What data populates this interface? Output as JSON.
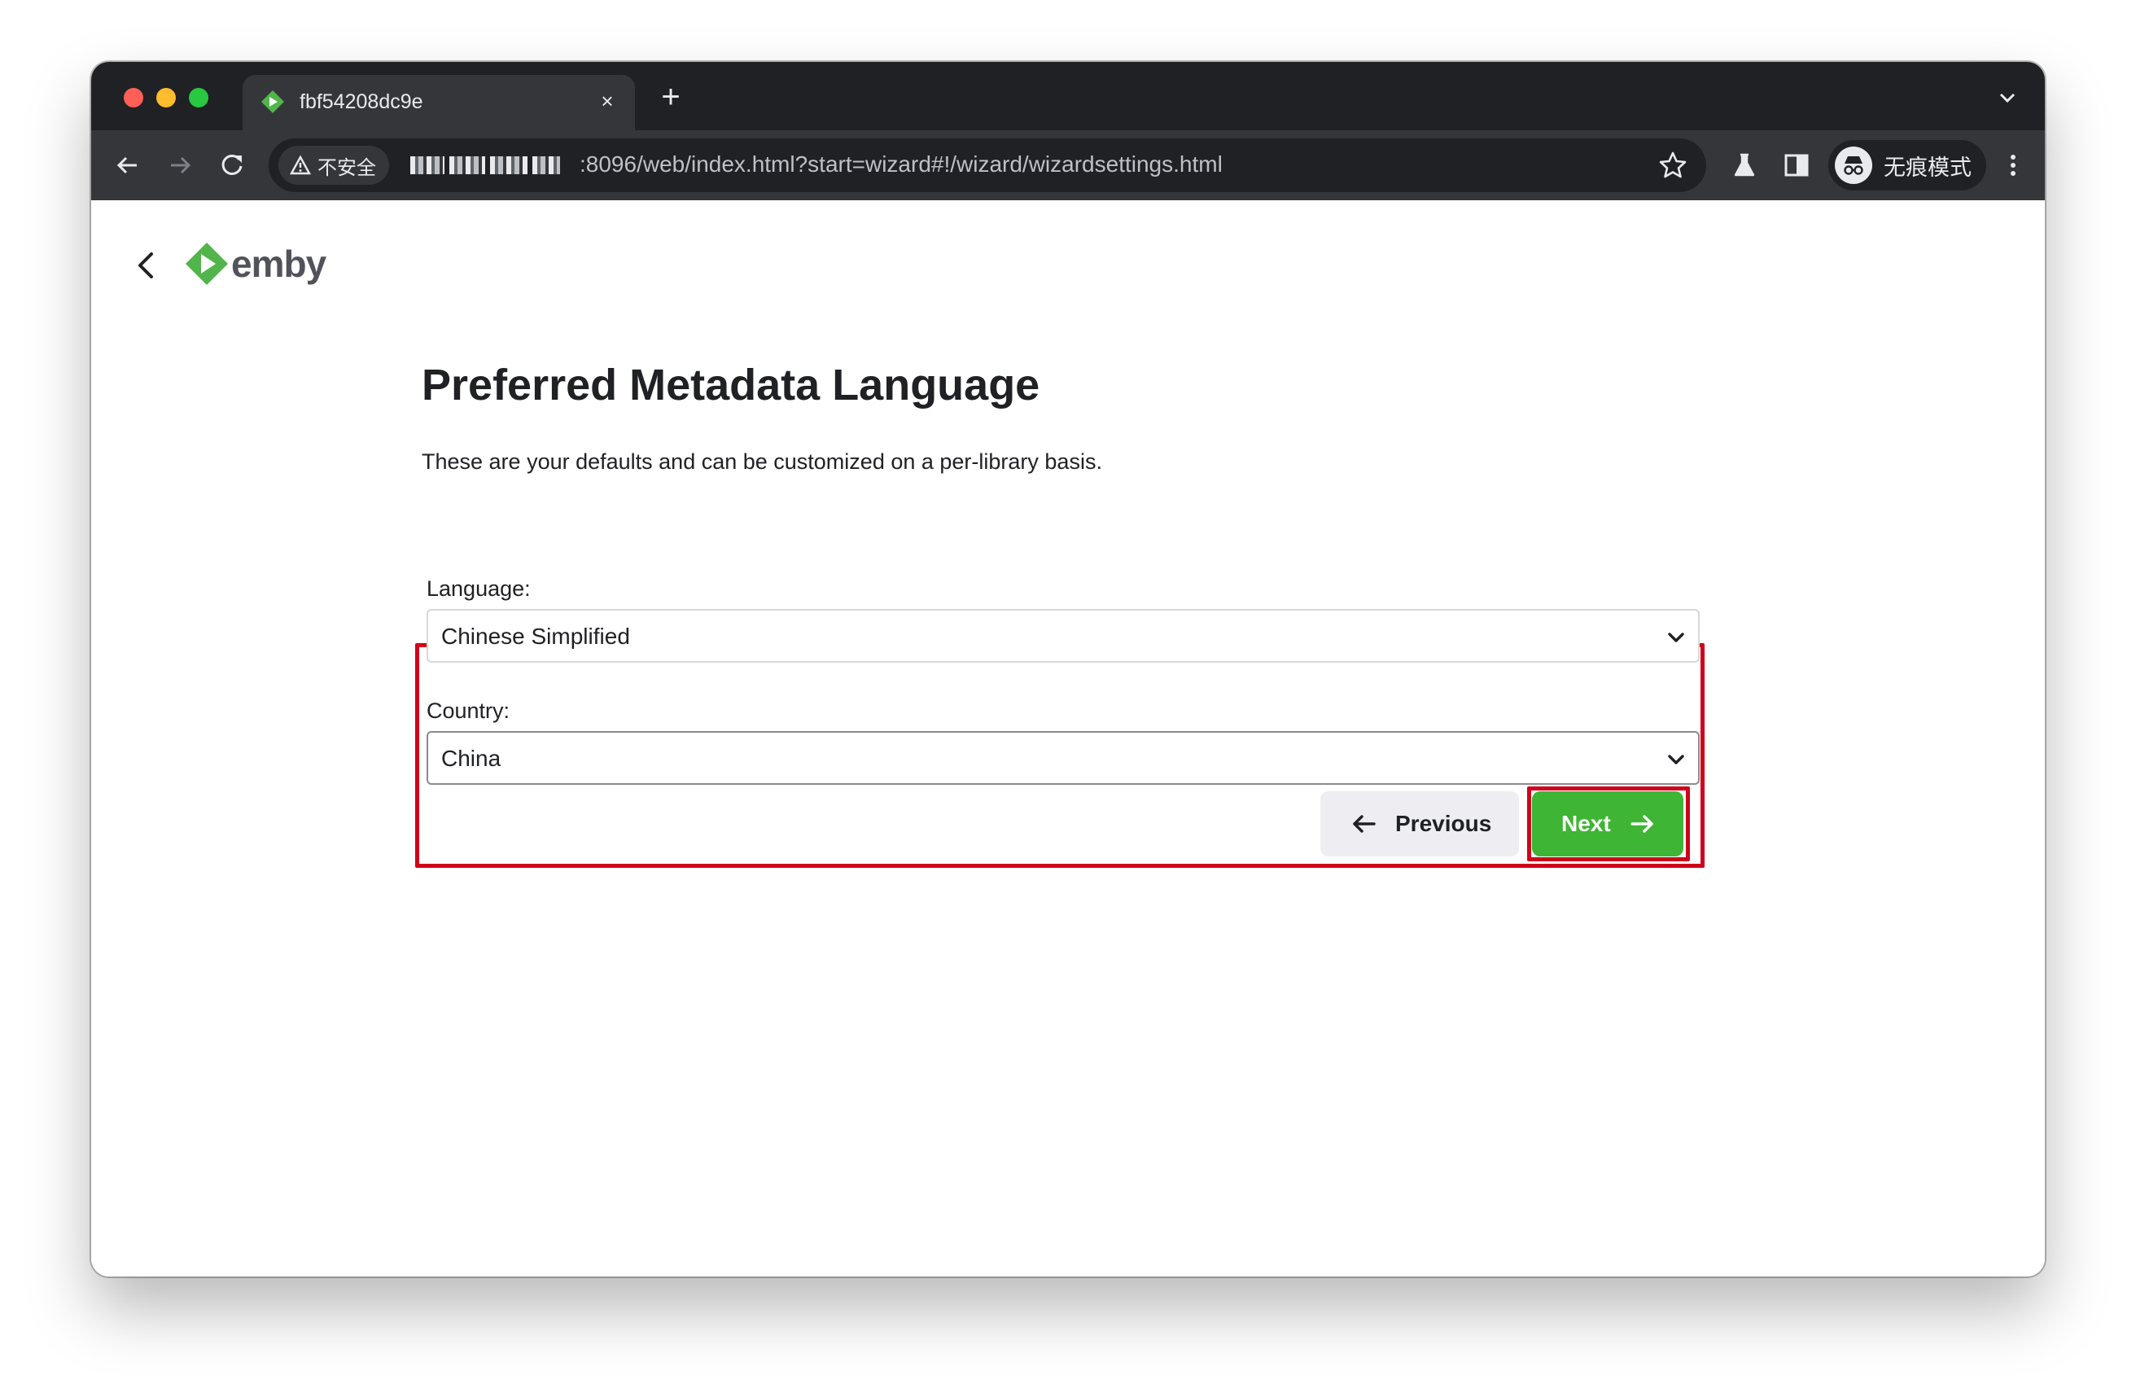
{
  "browser": {
    "tab_title": "fbf54208dc9e",
    "new_tab_symbol": "+",
    "close_symbol": "×",
    "security_label": "不安全",
    "url": ":8096/web/index.html?start=wizard#!/wizard/wizardsettings.html",
    "incognito_label": "无痕模式"
  },
  "header": {
    "logo_text": "emby"
  },
  "main": {
    "title": "Preferred Metadata Language",
    "subtitle": "These are your defaults and can be customized on a per-library basis.",
    "language_label": "Language:",
    "language_value": "Chinese Simplified",
    "country_label": "Country:",
    "country_value": "China",
    "previous_label": "Previous",
    "next_label": "Next"
  },
  "colors": {
    "accent_green": "#3eb534",
    "highlight_red": "#d0021b"
  }
}
